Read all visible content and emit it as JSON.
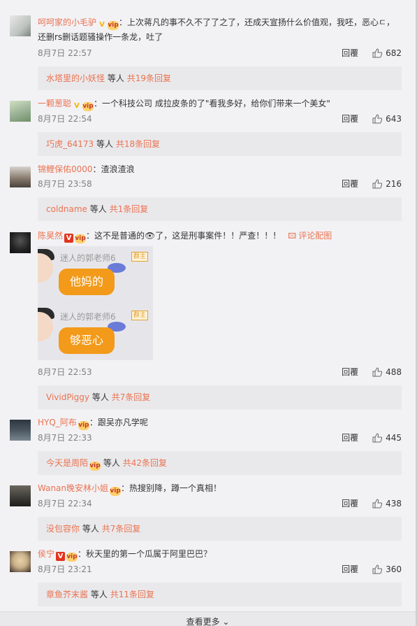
{
  "reply_label": "回覆",
  "others_label": "等人",
  "pic_link": {
    "icon": "image-icon",
    "label": "评论配图"
  },
  "comments": [
    {
      "username": "呵呵家的小毛驴",
      "verified": "gold-v",
      "vip": true,
      "text": "：上次蒋凡的事不久不了了之了，还成天宣扬什么价值观，我呸，恶心ㄷ，还删rs删话题骚操作一条龙，吐了",
      "time": "8月7日 22:57",
      "likes": "682",
      "sub_user": "水塔里的小妖怪",
      "sub_count": "共19条回复",
      "avatar_color": "#bfc4c0"
    },
    {
      "username": "一颗葱聪",
      "verified": "gold-v",
      "vip": true,
      "text": "：一个科技公司 成拉皮条的了\"看我多好，给你们带来一个美女\"",
      "time": "8月7日 22:54",
      "likes": "643",
      "sub_user": "巧虎_64173",
      "sub_count": "共18条回复",
      "avatar_color": "#9fb59a"
    },
    {
      "username": "锦鲤保佑0000",
      "verified": "",
      "vip": false,
      "text": "：渣浪渣浪",
      "time": "8月7日 23:58",
      "likes": "216",
      "sub_user": "coldname",
      "sub_count": "共1条回复",
      "avatar_color": "#8a7d70"
    },
    {
      "username": "陈昊然",
      "verified": "red-v",
      "vip": true,
      "text": "：这不是普通的👁了，这是刑事案件！！严查！！！",
      "time": "8月7日 22:53",
      "likes": "488",
      "sub_user": "VividPiggy",
      "sub_count": "共7条回复",
      "avatar_color": "#2a2a2a",
      "image": {
        "stickers": [
          {
            "name": "迷人的郭老师6",
            "tag": "群主",
            "bubble": "他妈的"
          },
          {
            "name": "迷人的郭老师6",
            "tag": "群主",
            "bubble": "够恶心"
          }
        ]
      }
    },
    {
      "username": "HYQ_阿布",
      "verified": "",
      "vip": true,
      "text": "：跟吴亦凡学呢",
      "time": "8月7日 22:33",
      "likes": "445",
      "sub_user": "今天是周陌",
      "sub_vip": true,
      "sub_count": "共42条回复",
      "avatar_color": "#4a5560"
    },
    {
      "username": "Wanan晚安林小姐",
      "verified": "",
      "vip": true,
      "text": "：热搜别降，蹲一个真相！",
      "time": "8月7日 22:34",
      "likes": "438",
      "sub_user": "没包容你",
      "sub_count": "共7条回复",
      "avatar_color": "#3b3a36"
    },
    {
      "username": "侯宁",
      "verified": "red-v",
      "vip": true,
      "text": "：秋天里的第一个瓜属于阿里巴巴？",
      "time": "8月7日 23:21",
      "likes": "360",
      "sub_user": "章鱼芥末酱",
      "sub_count": "共11条回复",
      "avatar_color": "#c9b08a"
    }
  ],
  "more_label": "查看更多 ⌄"
}
